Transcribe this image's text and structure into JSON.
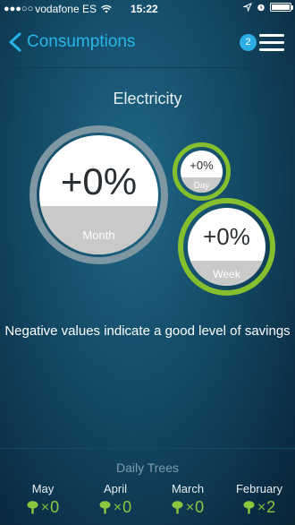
{
  "status_bar": {
    "carrier": "vodafone ES",
    "time": "15:22"
  },
  "nav": {
    "back_label": "Consumptions",
    "badge_count": "2"
  },
  "section_title": "Electricity",
  "gauges": {
    "month": {
      "value": "+0%",
      "label": "Month"
    },
    "day": {
      "value": "+0%",
      "label": "Day"
    },
    "week": {
      "value": "+0%",
      "label": "Week"
    }
  },
  "note": "Negative values indicate a good level of savings",
  "daily_trees": {
    "title": "Daily Trees",
    "items": [
      {
        "month": "May",
        "times": "×",
        "count": "0"
      },
      {
        "month": "April",
        "times": "×",
        "count": "0"
      },
      {
        "month": "March",
        "times": "×",
        "count": "0"
      },
      {
        "month": "February",
        "times": "×",
        "count": "2"
      }
    ]
  },
  "colors": {
    "accent_blue": "#29b5ea",
    "ring_green": "#85bf2e",
    "ring_grey": "#7f97a3",
    "tree_green": "#8cc63f"
  }
}
